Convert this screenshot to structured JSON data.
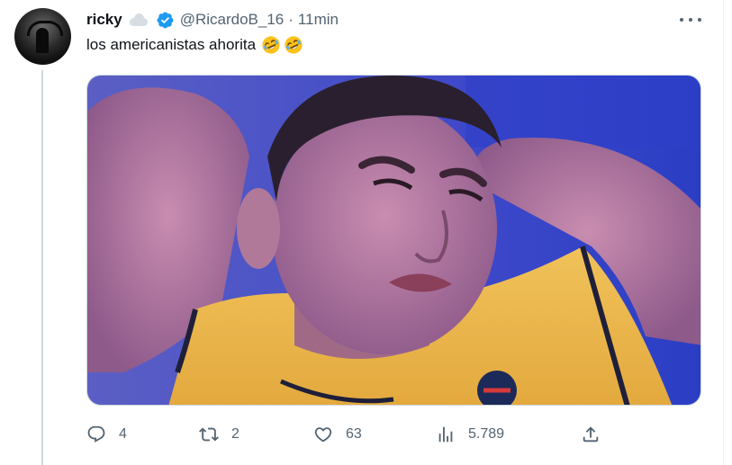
{
  "tweet": {
    "author_name": "ricky",
    "handle": "@RicardoB_16",
    "separator": "·",
    "time": "11min",
    "text": "los americanistas ahorita",
    "emoji": [
      "rolling-on-floor-laughing",
      "rolling-on-floor-laughing"
    ],
    "badge_icons": [
      "cloud-icon",
      "verified-badge-icon"
    ],
    "verified_color": "#1d9bf0",
    "media": {
      "description_icon": "photo-crying-fan"
    }
  },
  "actions": {
    "reply_count": "4",
    "retweet_count": "2",
    "like_count": "63",
    "views_count": "5.789",
    "icons": [
      "reply-icon",
      "retweet-icon",
      "like-icon",
      "views-icon",
      "share-icon"
    ]
  },
  "colors": {
    "text_primary": "#0f1419",
    "text_secondary": "#536471",
    "accent": "#1d9bf0"
  }
}
